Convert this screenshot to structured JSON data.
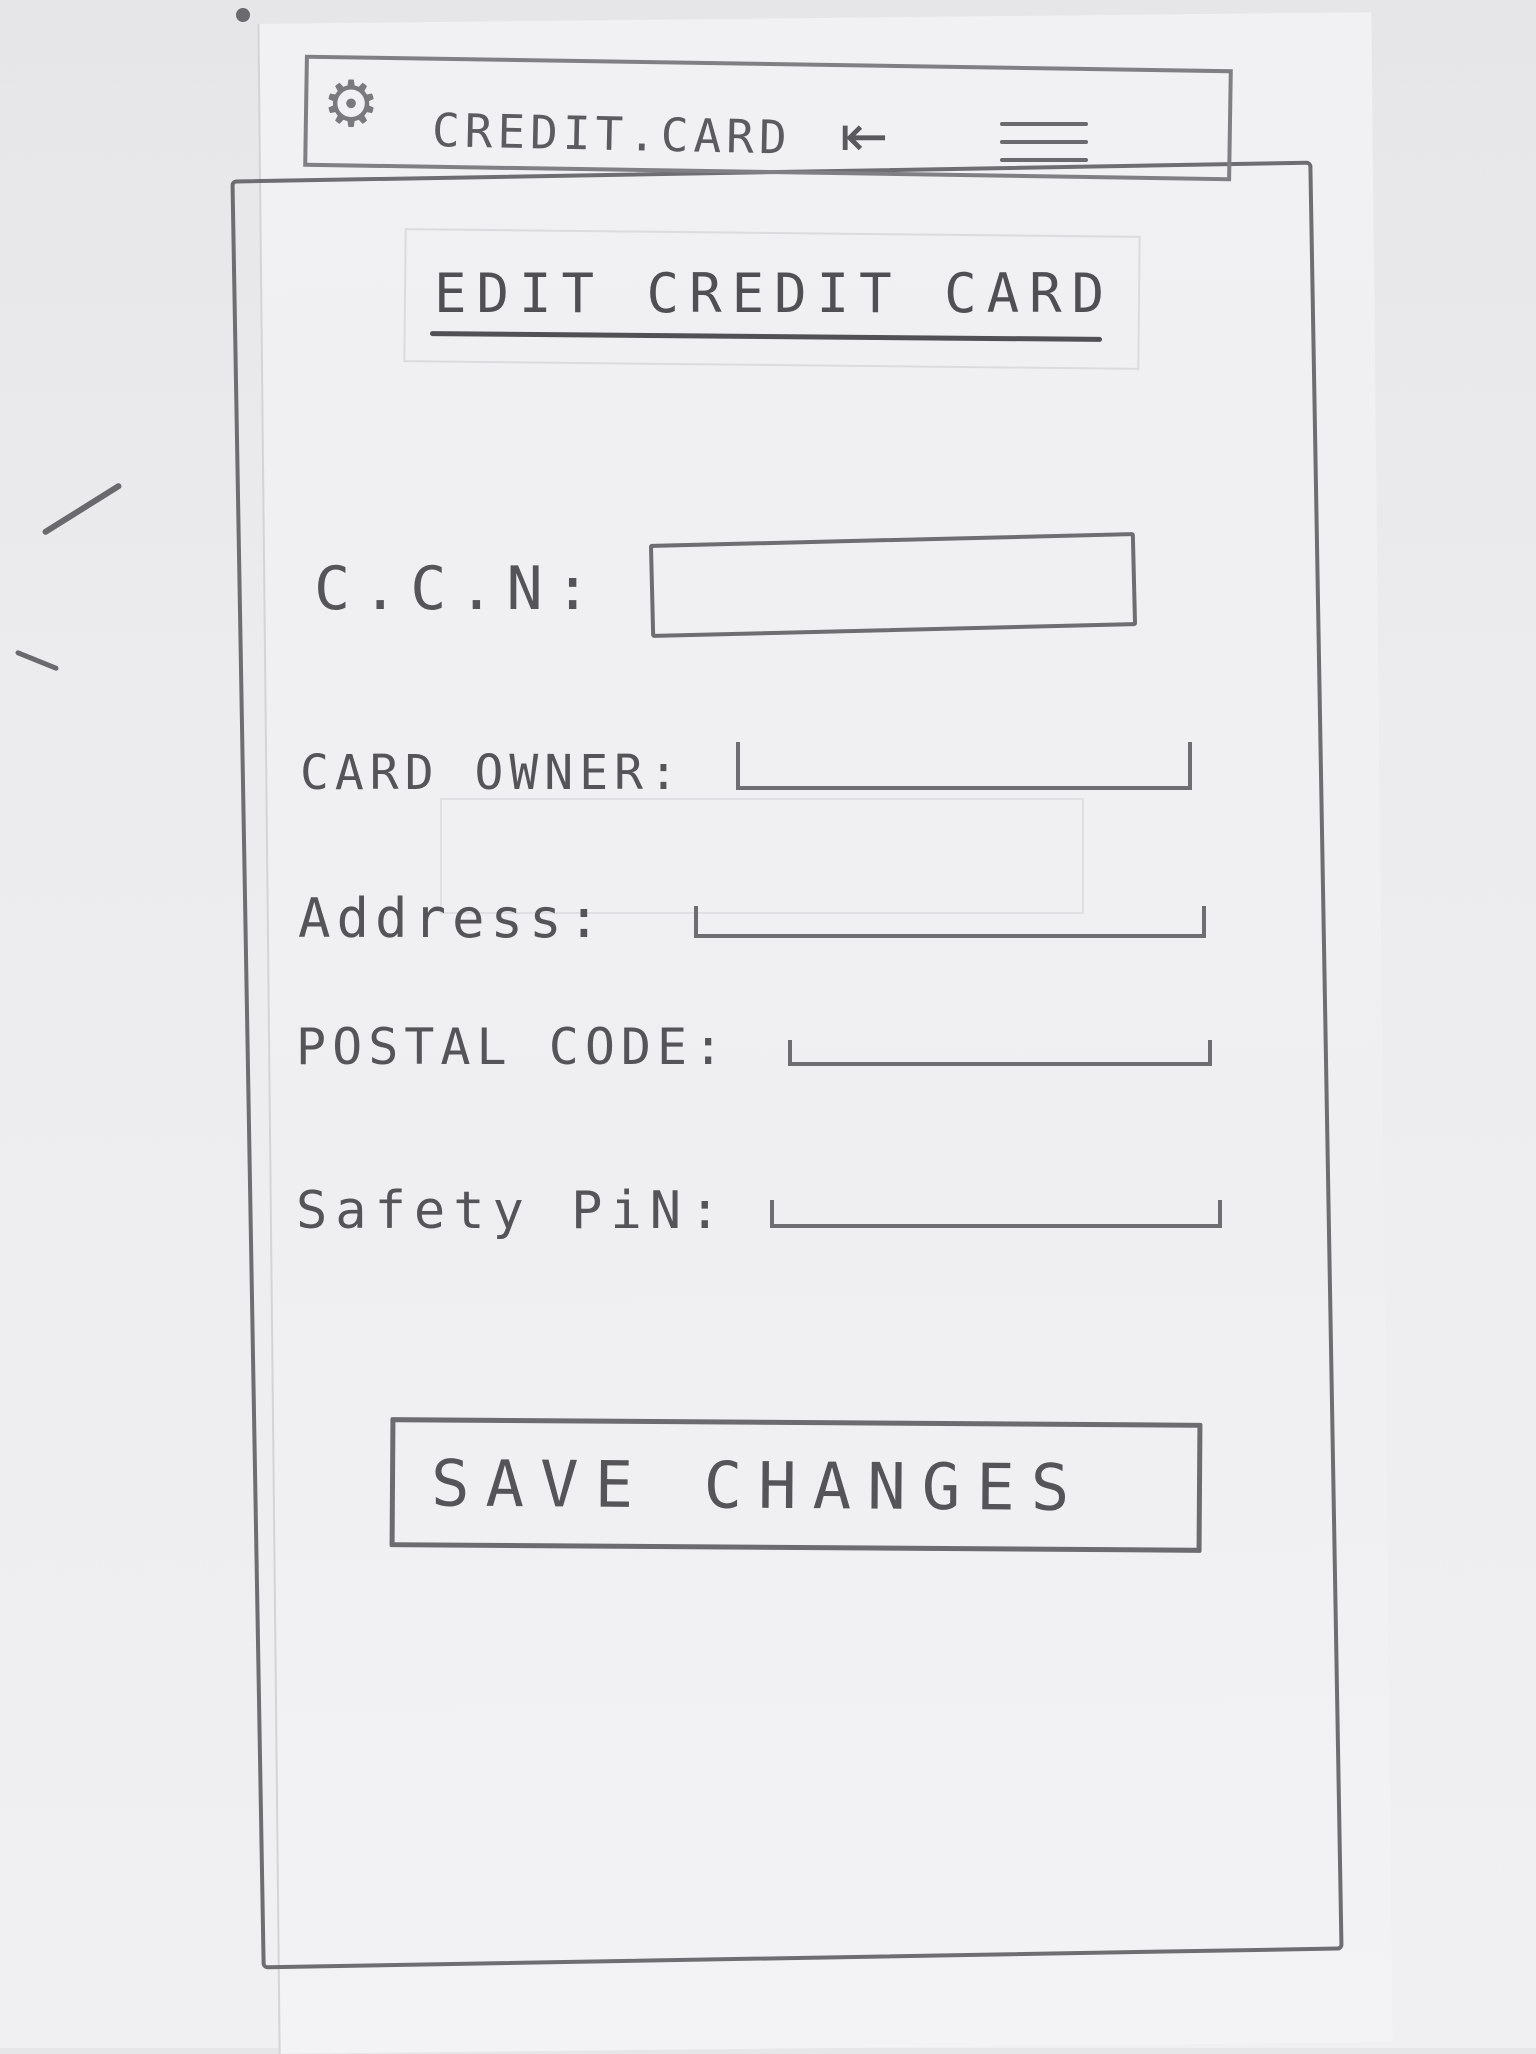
{
  "app_bar": {
    "title": "CREDIT.CARD",
    "icons": {
      "app": "gear-icon",
      "back": "back-arrow-icon",
      "menu": "hamburger-menu-icon"
    }
  },
  "page": {
    "title": "EDIT CREDIT CARD"
  },
  "form": {
    "fields": [
      {
        "label": "C.C.N:",
        "value": ""
      },
      {
        "label": "CARD OWNER:",
        "value": ""
      },
      {
        "label": "Address:",
        "value": ""
      },
      {
        "label": "POSTAL CODE:",
        "value": ""
      },
      {
        "label": "Safety PiN:",
        "value": ""
      }
    ]
  },
  "actions": {
    "save_label": "SAVE CHANGES"
  }
}
